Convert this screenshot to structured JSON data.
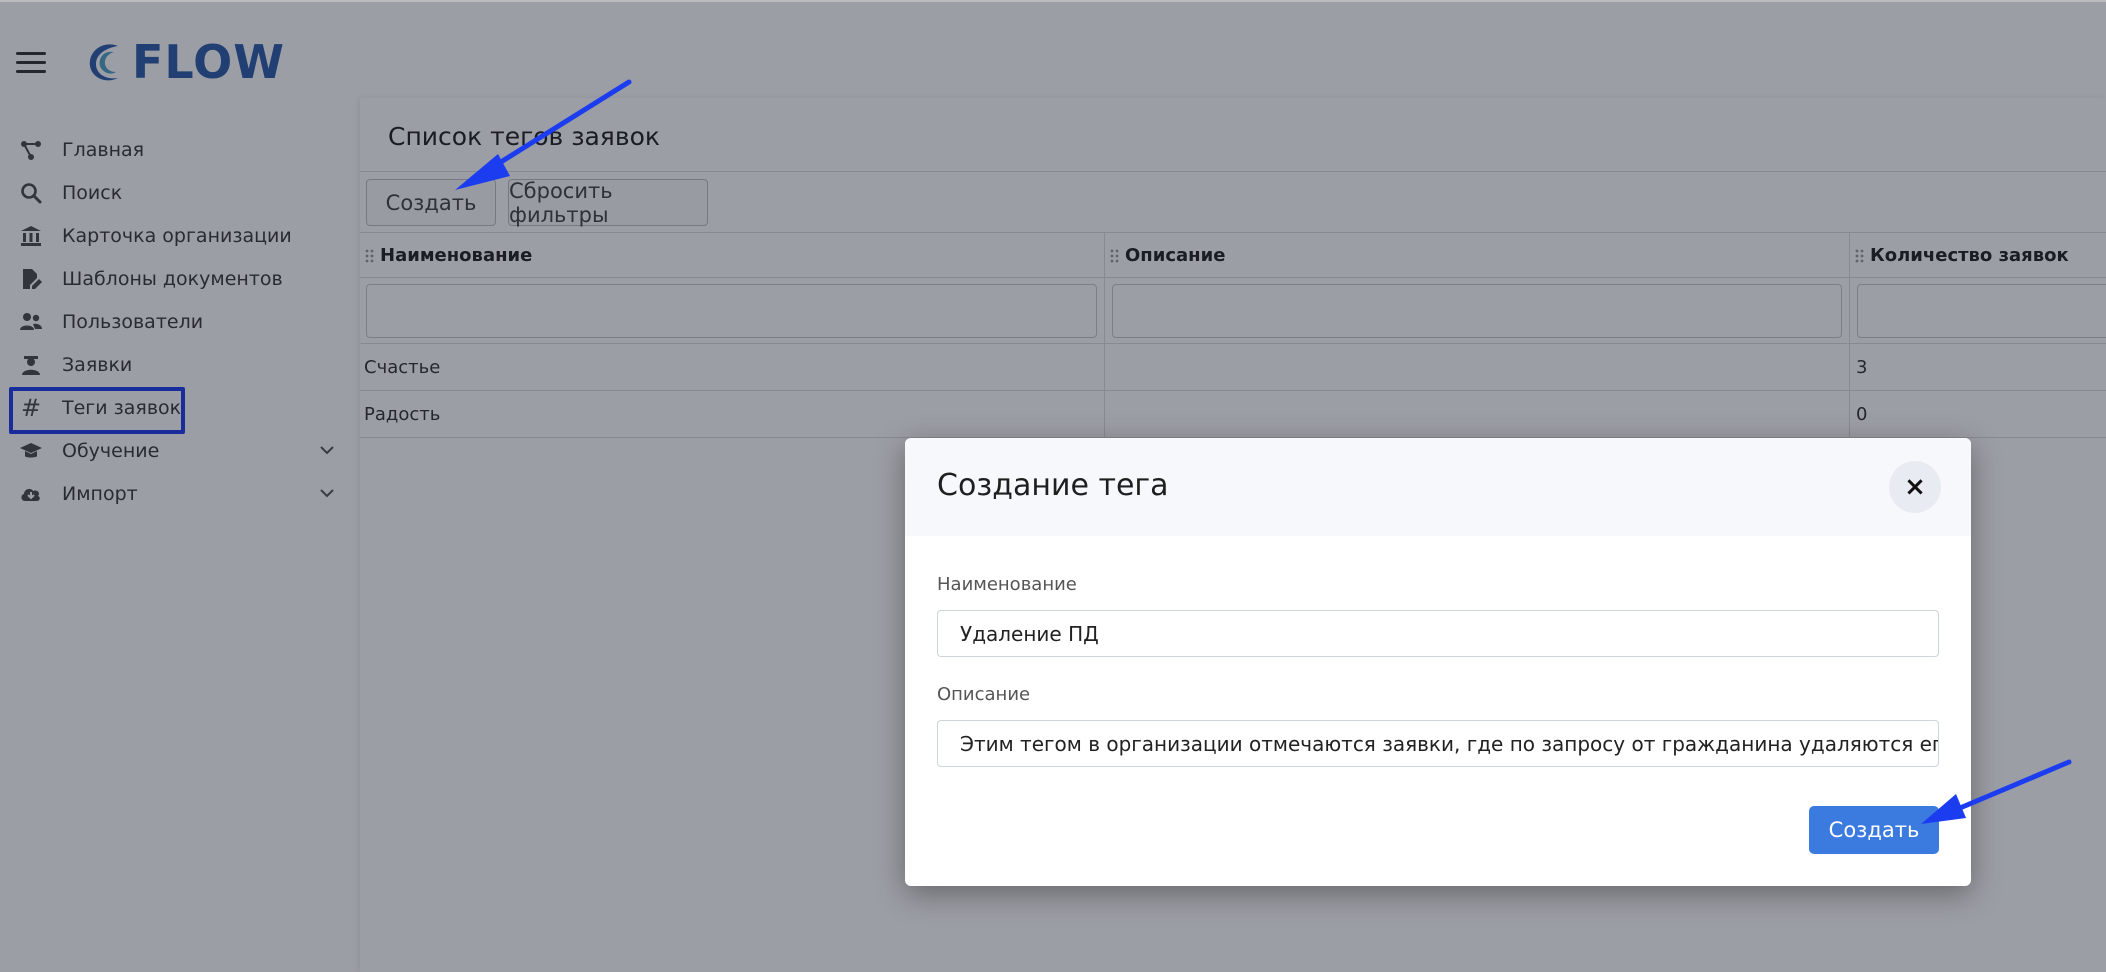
{
  "app": {
    "logo_text": "FLOW",
    "brand_color": "#2b5ca8"
  },
  "sidebar": {
    "items": [
      {
        "label": "Главная",
        "icon": "flow-icon"
      },
      {
        "label": "Поиск",
        "icon": "search-icon"
      },
      {
        "label": "Карточка организации",
        "icon": "bank-icon"
      },
      {
        "label": "Шаблоны документов",
        "icon": "document-edit-icon"
      },
      {
        "label": "Пользователи",
        "icon": "users-icon"
      },
      {
        "label": "Заявки",
        "icon": "user-tie-icon"
      },
      {
        "label": "Теги заявок",
        "icon": "hash-icon"
      },
      {
        "label": "Обучение",
        "icon": "graduation-cap-icon"
      },
      {
        "label": "Импорт",
        "icon": "cloud-download-icon"
      }
    ]
  },
  "main": {
    "title": "Список тегов заявок",
    "create_button": "Создать",
    "reset_button": "Сбросить фильтры",
    "columns": [
      "Наименование",
      "Описание",
      "Количество заявок"
    ],
    "rows": [
      {
        "name": "Счастье",
        "description": "",
        "count": "3"
      },
      {
        "name": "Радость",
        "description": "",
        "count": "0"
      }
    ]
  },
  "modal": {
    "title": "Создание тега",
    "close_glyph": "×",
    "name_label": "Наименование",
    "name_value": "Удаление ПД",
    "description_label": "Описание",
    "description_value": "Этим тегом в организации отмечаются заявки, где по запросу от гражданина удаляются его д",
    "submit_button": "Создать"
  },
  "colors": {
    "primary": "#3b7be0",
    "annotation": "#1c3cf0"
  }
}
